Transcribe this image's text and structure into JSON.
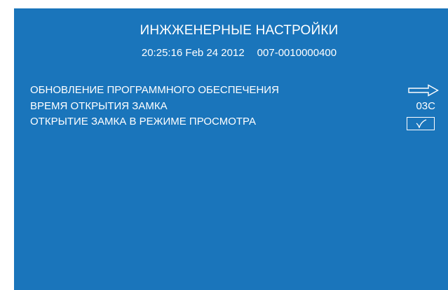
{
  "header": {
    "title": "ИНЖЖЕНЕРНЫЕ НАСТРОЙКИ",
    "datetime": "20:25:16 Feb 24 2012",
    "serial": "007-0010000400"
  },
  "settings": [
    {
      "label": "ОБНОВЛЕНИЕ ПРОГРАММНОГО ОБЕСПЕЧЕНИЯ",
      "control": "arrow-right-icon"
    },
    {
      "label": "ВРЕМЯ ОТКРЫТИЯ ЗАМКА",
      "value": "03С"
    },
    {
      "label": "ОТКРЫТИЕ ЗАМКА В РЕЖИМЕ ПРОСМОТРА",
      "checked": true,
      "control": "checkmark-icon"
    }
  ],
  "colors": {
    "background": "#1a75bb",
    "text": "#ffffff"
  }
}
